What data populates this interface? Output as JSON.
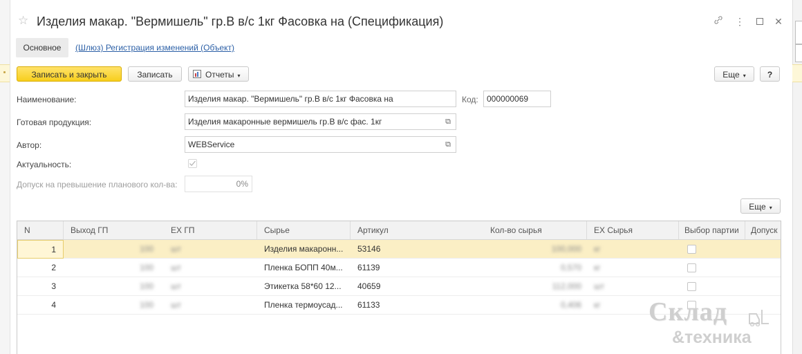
{
  "window": {
    "title": "Изделия макар. \"Вермишель\" гр.В в/с 1кг Фасовка на (Спецификация)"
  },
  "tabs": {
    "main": "Основное",
    "link": "(Шлюз) Регистрация изменений (Объект)"
  },
  "toolbar": {
    "save_close": "Записать и закрыть",
    "save": "Записать",
    "reports": "Отчеты",
    "more": "Еще",
    "help": "?"
  },
  "form": {
    "name_label": "Наименование:",
    "name_value": "Изделия макар. \"Вермишель\" гр.В в/с 1кг Фасовка на",
    "code_label": "Код:",
    "code_value": "000000069",
    "product_label": "Готовая продукция:",
    "product_value": "Изделия макаронные вермишель гр.В в/с фас. 1кг",
    "author_label": "Автор:",
    "author_value": "WEBService",
    "actual_label": "Актуальность:",
    "actual_checked": true,
    "tolerance_label": "Допуск на превышение планового кол-ва:",
    "tolerance_value": "0%"
  },
  "table": {
    "more": "Еще",
    "columns": [
      "N",
      "Выход ГП",
      "ЕХ ГП",
      "Сырье",
      "Артикул",
      "Кол-во сырья",
      "ЕХ Сырья",
      "Выбор партии",
      "Допуск"
    ],
    "rows": [
      {
        "n": "1",
        "out": "100",
        "unit": "шт",
        "material": "Изделия макаронн...",
        "article": "53146",
        "qty": "100,000",
        "munit": "кг",
        "selected": true
      },
      {
        "n": "2",
        "out": "100",
        "unit": "шт",
        "material": "Пленка БОПП 40м...",
        "article": "61139",
        "qty": "0,570",
        "munit": "кг",
        "selected": false
      },
      {
        "n": "3",
        "out": "100",
        "unit": "шт",
        "material": "Этикетка 58*60 12...",
        "article": "40659",
        "qty": "112,000",
        "munit": "шт",
        "selected": false
      },
      {
        "n": "4",
        "out": "100",
        "unit": "шт",
        "material": "Пленка термоусад...",
        "article": "61133",
        "qty": "0,406",
        "munit": "кг",
        "selected": false
      }
    ]
  },
  "watermark": {
    "line1": "Склад",
    "line2": "&техника"
  },
  "colors": {
    "primary_button": "#f7cf1d",
    "link": "#2b5fa6",
    "selected_row": "#fbefc5"
  }
}
